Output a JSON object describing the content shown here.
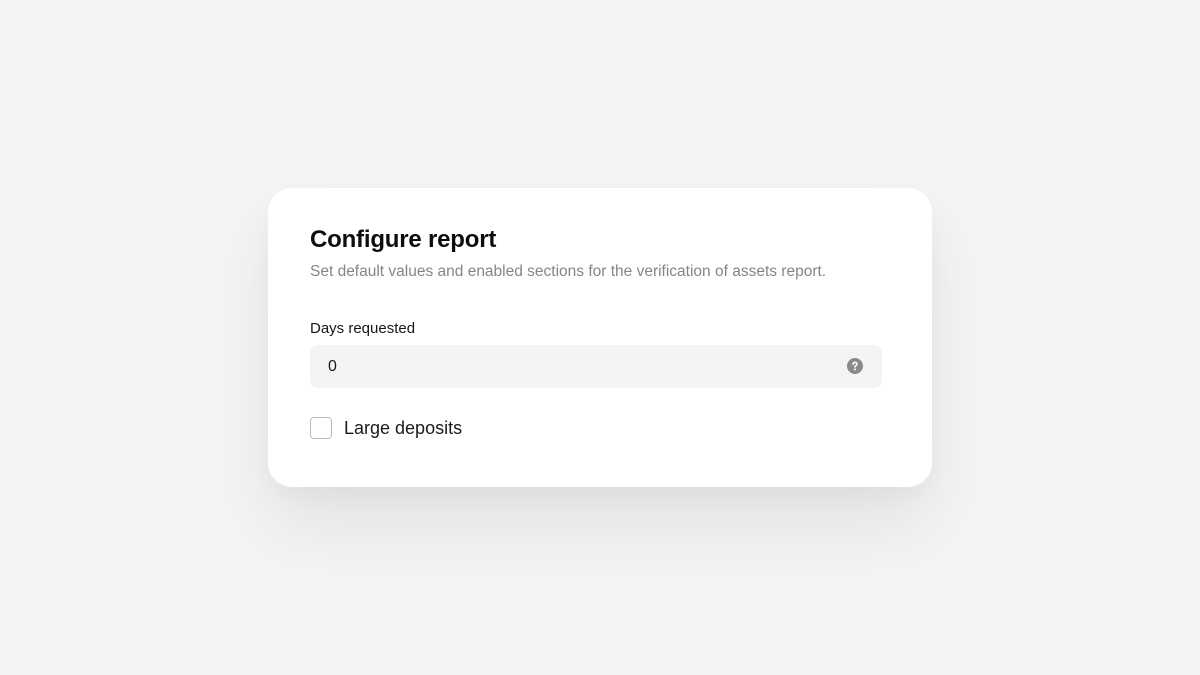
{
  "dialog": {
    "title": "Configure report",
    "subtitle": "Set default values and enabled sections for the verification of assets report."
  },
  "days_requested": {
    "label": "Days requested",
    "value": "0",
    "icon": "help-circle-icon"
  },
  "large_deposits": {
    "label": "Large deposits",
    "checked": false
  },
  "colors": {
    "background": "#f4f4f4",
    "card": "#ffffff",
    "input_bg": "#f4f4f4",
    "help_icon": "#8a8a8a",
    "subtitle_text": "#858585"
  }
}
